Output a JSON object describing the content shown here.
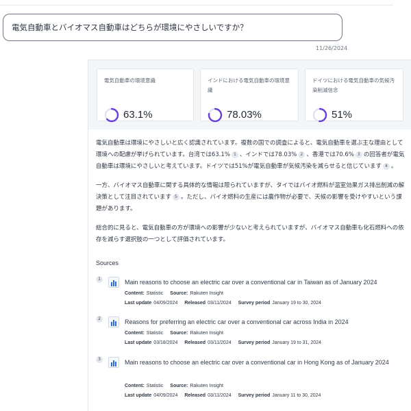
{
  "question": {
    "text": "電気自動車とバイオマス自動車はどちらが環境にやさしいですか？",
    "date": "11/26/2024"
  },
  "stats": [
    {
      "title": "電気自動車の環境意識",
      "value": "63.1%",
      "fraction": 0.631
    },
    {
      "title": "インドにおける電気自動車の環境意識",
      "value": "78.03%",
      "fraction": 0.7803
    },
    {
      "title": "ドイツにおける電気自動車の気候汚染削減信念",
      "value": "51%",
      "fraction": 0.51
    }
  ],
  "colors": {
    "accent": "#6a3fd4",
    "ring_track": "#e3e0f2"
  },
  "answer": {
    "p1": {
      "a": "電気自動車は環境にやさしいと広く認識されています。複数の国での調査によると、電気自動車を選ぶ主な理由として環境への配慮が挙げられています。台湾では63.1%",
      "c1": "1",
      "b": "、インドでは78.03%",
      "c2": "2",
      "c": "、香港では70.6%",
      "c3": "3",
      "d": "の回答者が電気自動車は環境にやさしいと考えています。ドイツでは51%が電気自動車が気候汚染を減らせると信じています",
      "c4": "4",
      "e": "。"
    },
    "p2": {
      "a": "一方、バイオマス自動車に関する具体的な情報は限られていますが、タイではバイオ燃料が温室効果ガス排出削減の解決策として注目されています",
      "c5": "5",
      "b": "。ただし、バイオ燃料の生産には農作物が必要で、天候の影響を受けやすいという課題があります。"
    },
    "p3": "総合的に見ると、電気自動車の方が環境への影響が少ないと考えられていますが、バイオマス自動車も化石燃料への依存を減らす選択肢の一つとして評価されています。"
  },
  "sources_title": "Sources",
  "meta_labels": {
    "content": "Content:",
    "source": "Source:",
    "last_update": "Last update",
    "released": "Released",
    "survey_period": "Survey period"
  },
  "sources": [
    {
      "num": "1",
      "icon": "bar-chart-icon",
      "title": "Main reasons to choose an electric car over a conventional car in Taiwan as of January 2024",
      "content": "Statistic",
      "source": "Rakuten Insight",
      "last_update": "04/09/2024",
      "released": "03/11/2024",
      "survey_period": "January 19 to 30, 2024"
    },
    {
      "num": "2",
      "icon": "bar-chart-icon",
      "title": "Reasons for preferring an electric car over a conventional car across India in 2024",
      "content": "Statistic",
      "source": "Rakuten Insight",
      "last_update": "03/18/2024",
      "released": "03/11/2024",
      "survey_period": "January 19 to 31, 2024"
    },
    {
      "num": "3",
      "icon": "bar-chart-icon",
      "title": "Main reasons to choose an electric car over a conventional car in Hong Kong as of January 2024",
      "content": "Statistic",
      "source": "Rakuten Insight",
      "last_update": "04/09/2024",
      "released": "03/11/2024",
      "survey_period": "January 11 to 30, 2024"
    }
  ]
}
